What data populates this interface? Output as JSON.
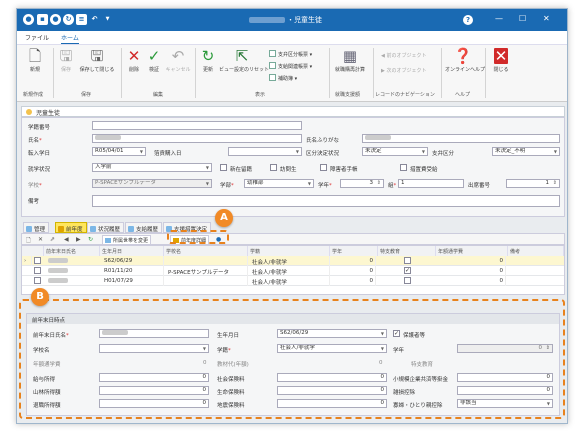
{
  "window": {
    "title": "・児童生徒",
    "help_icon": "help-icon",
    "min_icon": "minimize-icon",
    "max_icon": "maximize-icon",
    "close_icon": "close-icon"
  },
  "menu": {
    "file": "ファイル",
    "home": "ホーム"
  },
  "ribbon": {
    "new": "新規",
    "save": "保存",
    "save_close": "保存して閉じる",
    "delete": "削除",
    "verify": "検証",
    "cancel": "キャンセル",
    "refresh": "更新",
    "view_reset": "ビュー設定のリセット",
    "payment_list": "支弁区分帳票",
    "payment_related": "支給関連帳票",
    "supplement": "補助簿",
    "employment": "就職購再計算",
    "prev_object": "前のオブジェクト",
    "next_object": "次のオブジェクト",
    "online_help": "オンラインヘルプ",
    "close": "閉じる",
    "groups": {
      "new_create": "新規作成",
      "save": "保存",
      "edit": "編集",
      "display": "表示",
      "employment_group": "就職支援額",
      "record_nav": "レコードのナビゲーション",
      "help": "ヘルプ"
    }
  },
  "doc": {
    "tab": "児童生徒"
  },
  "form": {
    "student_no_label": "学籍番号",
    "name_label": "氏名",
    "name_kana_label": "氏名ふりがな",
    "admission_label": "転入学日",
    "admission_value": "R05/04/01",
    "rejected_date_label": "箔貢購入日",
    "district_label": "区分決定状況",
    "district_value": "未決定",
    "support_label": "支弁区分",
    "support_value": "未決定_不明",
    "status_label": "就学状況",
    "status_value": "入学前",
    "chk_newly": "新在留籍",
    "chk_visit": "訪問生",
    "chk_disability": "障害者手帳",
    "chk_recipient": "措置費受給",
    "school_label": "学校",
    "school_value": "P-SPACEサンプルデータ",
    "dept_label": "学部",
    "dept_value": "幼稚部",
    "grade_label": "学年",
    "grade_value": "3",
    "class_label": "組",
    "class_value": "1",
    "attendance_no_label": "出席番号",
    "attendance_no_value": "1",
    "remarks_label": "備考"
  },
  "tabs": {
    "guardian": "管理",
    "history": "前年度",
    "status_history": "状況履歴",
    "payment_history": "支給履歴",
    "payment_calc": "支援措置決定"
  },
  "gridtool": {
    "income_btn": "所属世帯を変更",
    "prev_detail_btn": "前年度詳細"
  },
  "grid": {
    "columns": [
      "",
      "前年末日氏名",
      "生年月日",
      "学校名",
      "学籍",
      "学年",
      "特支教育",
      "年額通学費",
      "備考"
    ],
    "rows": [
      {
        "birth": "S62/06/29",
        "school": "",
        "dept": "社会人/非就学",
        "grade": "0",
        "special": false,
        "fare": "0"
      },
      {
        "birth": "R01/11/20",
        "school": "P-SPACEサンプルデータ",
        "dept": "社会人/非就学",
        "grade": "0",
        "special": true,
        "fare": "0"
      },
      {
        "birth": "H01/07/29",
        "school": "",
        "dept": "社会人/非就学",
        "grade": "0",
        "special": false,
        "fare": "0"
      }
    ]
  },
  "section": {
    "header": "前年末日時点",
    "prev_name_label": "前年末日氏名",
    "birth_label": "生年月日",
    "birth_value": "S62/06/29",
    "guardian_label": "保護者等",
    "guardian_checked": true,
    "school_label": "学校名",
    "dept_label": "学籍",
    "dept_value": "社会人/非就学",
    "grade_label": "学年",
    "grade_value": "0",
    "annual_fare_label": "年額通学費",
    "annual_fare_value": "0",
    "textbook_label": "教材代(年額)",
    "textbook_value": "0",
    "special_label": "特支教育",
    "income_label": "給与所得",
    "income_value": "0",
    "social_ins_label": "社会保険料",
    "social_ins_value": "0",
    "small_biz_label": "小規模企業共済等掛金",
    "small_biz_value": "0",
    "forest_label": "山林所得額",
    "forest_value": "0",
    "life_ins_label": "生命保険料",
    "life_ins_value": "0",
    "misc_label": "雑損控除",
    "misc_value": "0",
    "retire_label": "退職所得額",
    "retire_value": "0",
    "earthquake_label": "地震保険料",
    "earthquake_value": "0",
    "widow_label": "寡婦・ひとり親控除",
    "widow_value": "非該当"
  },
  "callouts": {
    "a": "A",
    "b": "B"
  },
  "colors": {
    "accent": "#1a6ab3",
    "callout": "#e8821c",
    "selected_tab": "#ffe65c"
  }
}
